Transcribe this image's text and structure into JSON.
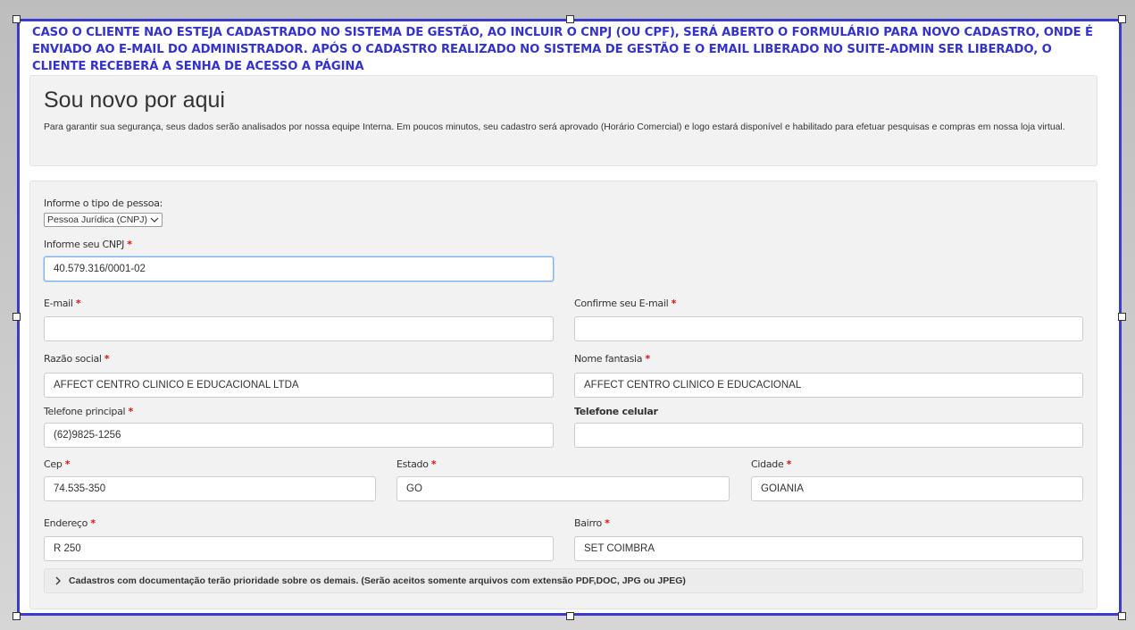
{
  "notice_text": "CASO O CLIENTE NAO ESTEJA CADASTRADO NO SISTEMA DE GESTÃO, AO INCLUIR O CNPJ (OU CPF), SERÁ ABERTO O FORMULÁRIO PARA NOVO CADASTRO, ONDE É ENVIADO AO E-MAIL DO ADMINISTRADOR. APÓS O CADASTRO REALIZADO NO SISTEMA DE GESTÃO E O EMAIL LIBERADO NO SUITE-ADMIN SER LIBERADO, O CLIENTE RECEBERÁ A SENHA DE ACESSO A PÁGINA",
  "intro": {
    "title": "Sou novo por aqui",
    "description": "Para garantir sua segurança, seus dados serão analisados por nossa equipe Interna. Em poucos minutos, seu cadastro será aprovado (Horário Comercial) e logo estará disponível e habilitado para efetuar pesquisas e compras em nossa loja virtual."
  },
  "form": {
    "tipo_label": "Informe o tipo de pessoa:",
    "tipo_value": "Pessoa Jurídica (CNPJ)",
    "cnpj": {
      "label": "Informe seu CNPJ",
      "value": "40.579.316/0001-02"
    },
    "email": {
      "label": "E-mail",
      "value": ""
    },
    "email_confirm": {
      "label": "Confirme seu E-mail",
      "value": ""
    },
    "razao": {
      "label": "Razão social",
      "value": "AFFECT CENTRO CLINICO E EDUCACIONAL LTDA"
    },
    "fantasia": {
      "label": "Nome fantasia",
      "value": "AFFECT CENTRO CLINICO E EDUCACIONAL"
    },
    "telefone": {
      "label": "Telefone principal",
      "value": "(62)9825-1256"
    },
    "celular": {
      "label": "Telefone celular",
      "value": ""
    },
    "cep": {
      "label": "Cep",
      "value": "74.535-350"
    },
    "estado": {
      "label": "Estado",
      "value": "GO"
    },
    "cidade": {
      "label": "Cidade",
      "value": "GOIANIA"
    },
    "endereco": {
      "label": "Endereço",
      "value": "R 250"
    },
    "bairro": {
      "label": "Bairro",
      "value": "SET COIMBRA"
    },
    "required_mark": "*",
    "docs_accordion": "Cadastros com documentação terão prioridade sobre os demais. (Serão aceitos somente arquivos com extensão PDF,DOC, JPG ou JPEG)"
  },
  "icons": {
    "select_arrow": "chevron-down-icon",
    "accordion_arrow": "chevron-right-icon"
  },
  "colors": {
    "notice": "#3333cc",
    "frame": "#3c3ccc",
    "required": "#e01010"
  }
}
